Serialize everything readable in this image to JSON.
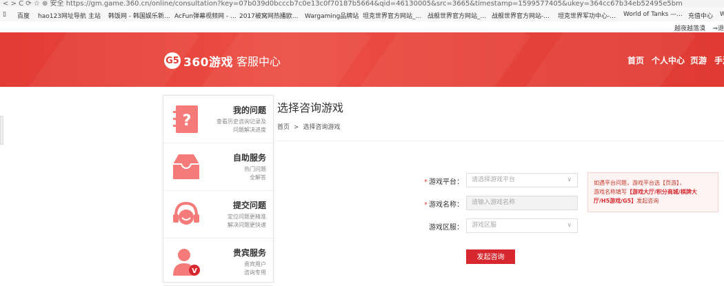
{
  "browser": {
    "address_text": "< > C ⟳ ☆ ⊕  安全 https://gm.game.360.cn/online/consultation?key=07b039d0bcccb7c0e13c0f70187b5664&qid=46130005&src=3665&timestamp=1599577405&ukey=364cc67b34eb52495e5bm",
    "bookmarks": [
      "百度",
      "hao123网址导航",
      "主站",
      "韩饭网 - 韩国娱乐新...",
      "AcFun弹幕视频网 - ...",
      "2017被窝网热播欧...",
      "Wargaming品牌站",
      "坦克世界官方网站_...",
      "战舰世界官方网站_...",
      "战舰世界官方网站-...",
      "坦克世界军功中心-...",
      "World of Tanks —...",
      "充值中心",
      "W"
    ],
    "user_name": "越夜越落漠",
    "logout_label": "⇒退"
  },
  "header": {
    "logo_badge": "G5",
    "logo_brand": "360游戏",
    "logo_sub": "客服中心",
    "nav": [
      "首页",
      "个人中心",
      "页游",
      "手游"
    ]
  },
  "sidebar": {
    "items": [
      {
        "title": "我的问题",
        "desc1": "查看历史咨询记录及",
        "desc2": "问题解决进度"
      },
      {
        "title": "自助服务",
        "desc1": "热门问题",
        "desc2": "全解答"
      },
      {
        "title": "提交问题",
        "desc1": "定位问题更精准",
        "desc2": "解决问题更快速"
      },
      {
        "title": "贵宾服务",
        "desc1": "贵宾用户",
        "desc2": "咨询专用"
      }
    ]
  },
  "main": {
    "title": "选择咨询游戏",
    "breadcrumb": {
      "home": "首页",
      "sep": ">",
      "current": "选择咨询游戏"
    },
    "form": {
      "platform_label": "游戏平台：",
      "platform_placeholder": "请选择游戏平台",
      "name_label": "游戏名称：",
      "name_placeholder": "请输入游戏名称",
      "region_label": "游戏区服：",
      "region_placeholder": "游戏区服",
      "required_mark": "*",
      "chevron": "∨",
      "submit_label": "发起咨询"
    },
    "notice": {
      "line1": "如遇平台问题，游戏平台选【页游】，",
      "line2a": "游戏名称填写",
      "line2b": "【游戏大厅/积分商城/棋牌大",
      "line3a": "厅/H5游戏/G5】",
      "line3b": "发起咨询"
    }
  },
  "colors": {
    "brand": "#e23b33",
    "button": "#d7282f",
    "icon": "#f47b79"
  }
}
